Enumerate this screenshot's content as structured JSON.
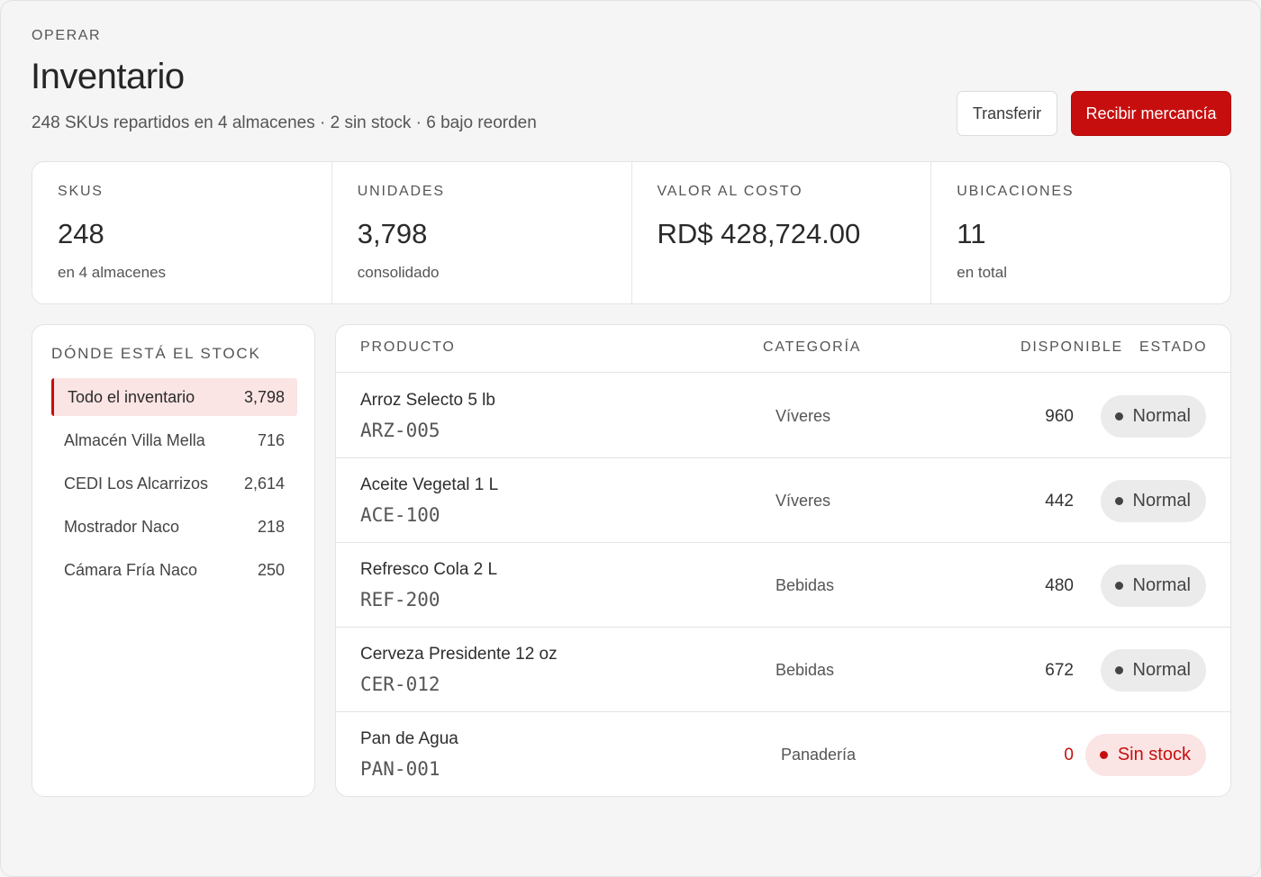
{
  "header": {
    "section": "OPERAR",
    "title": "Inventario",
    "subtitle": "248 SKUs repartidos en 4 almacenes · 2 sin stock · 6 bajo reorden",
    "transfer_label": "Transferir",
    "receive_label": "Recibir mercancía"
  },
  "stats": [
    {
      "label": "SKUS",
      "value": "248",
      "note": "en 4 almacenes"
    },
    {
      "label": "UNIDADES",
      "value": "3,798",
      "note": "consolidado"
    },
    {
      "label": "VALOR AL COSTO",
      "value": "RD$ 428,724.00",
      "note": ""
    },
    {
      "label": "UBICACIONES",
      "value": "11",
      "note": "en total"
    }
  ],
  "locations": {
    "heading": "DÓNDE ESTÁ EL STOCK",
    "items": [
      {
        "name": "Todo el inventario",
        "count": "3,798",
        "active": true
      },
      {
        "name": "Almacén Villa Mella",
        "count": "716"
      },
      {
        "name": "CEDI Los Alcarrizos",
        "count": "2,614"
      },
      {
        "name": "Mostrador Naco",
        "count": "218"
      },
      {
        "name": "Cámara Fría Naco",
        "count": "250"
      }
    ]
  },
  "table": {
    "columns": {
      "product": "PRODUCTO",
      "category": "CATEGORÍA",
      "available": "DISPONIBLE",
      "status": "ESTADO"
    },
    "rows": [
      {
        "name": "Arroz Selecto 5 lb",
        "sku": "ARZ-005",
        "category": "Víveres",
        "available": "960",
        "status": "Normal"
      },
      {
        "name": "Aceite Vegetal 1 L",
        "sku": "ACE-100",
        "category": "Víveres",
        "available": "442",
        "status": "Normal"
      },
      {
        "name": "Refresco Cola 2 L",
        "sku": "REF-200",
        "category": "Bebidas",
        "available": "480",
        "status": "Normal"
      },
      {
        "name": "Cerveza Presidente 12 oz",
        "sku": "CER-012",
        "category": "Bebidas",
        "available": "672",
        "status": "Normal"
      },
      {
        "name": "Pan de Agua",
        "sku": "PAN-001",
        "category": "Panadería",
        "available": "0",
        "status": "Sin stock"
      }
    ]
  },
  "colors": {
    "accent": "#c70e0e",
    "accent_soft": "#fbe4e4",
    "badge_neutral": "#ebebeb"
  }
}
